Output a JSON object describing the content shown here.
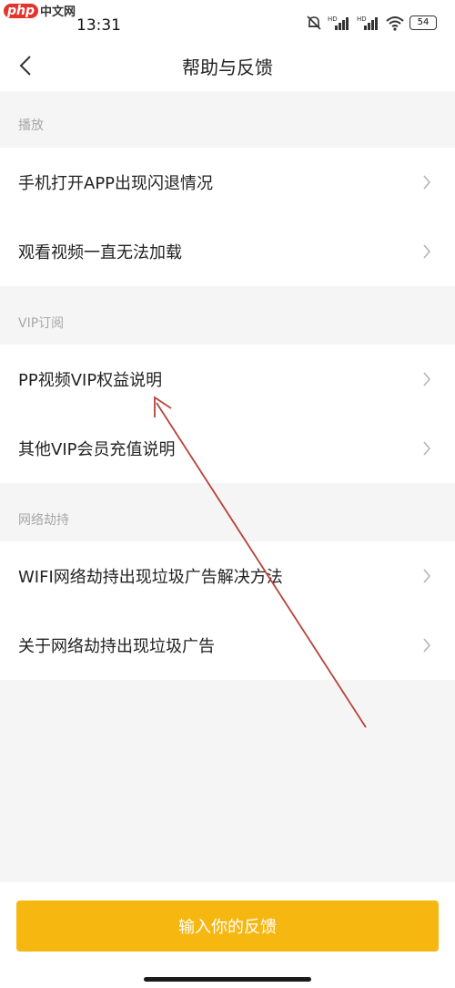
{
  "watermark": {
    "logo": "php",
    "text": "中文网"
  },
  "status": {
    "time": "13:31",
    "battery": "54",
    "hd1": "HD",
    "hd2": "HD"
  },
  "nav": {
    "title": "帮助与反馈"
  },
  "sections": [
    {
      "header": "播放",
      "items": [
        "手机打开APP出现闪退情况",
        "观看视频一直无法加载"
      ]
    },
    {
      "header": "VIP订阅",
      "items": [
        "PP视频VIP权益说明",
        "其他VIP会员充值说明"
      ]
    },
    {
      "header": "网络劫持",
      "items": [
        "WIFI网络劫持出现垃圾广告解决方法",
        "关于网络劫持出现垃圾广告"
      ]
    }
  ],
  "footer": {
    "button_label": "输入你的反馈"
  },
  "colors": {
    "accent": "#f7b711",
    "annotation_arrow": "#b5433a"
  },
  "icons": {
    "back": "chevron-left-icon",
    "row": "chevron-right-icon"
  }
}
